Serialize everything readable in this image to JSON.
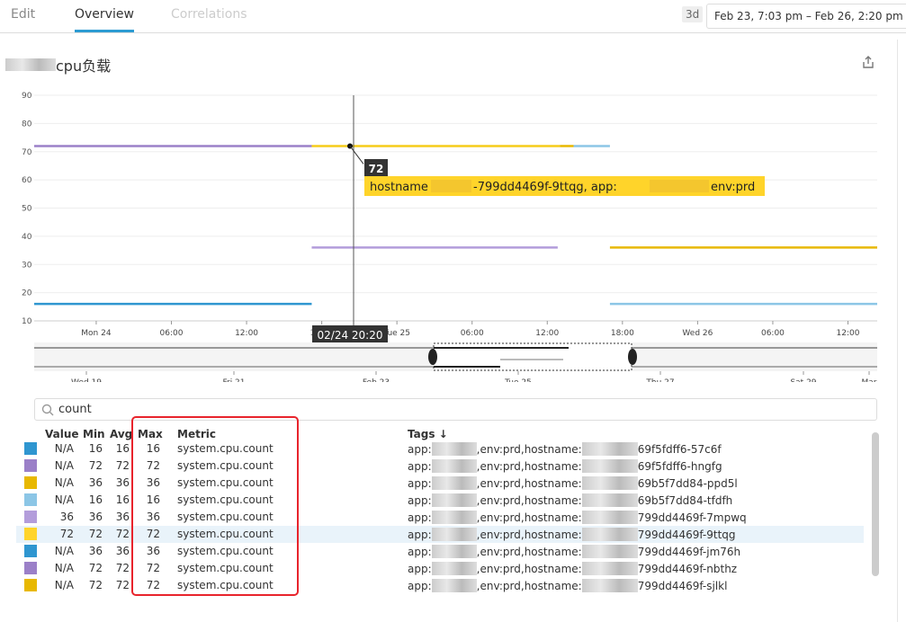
{
  "tabs": [
    {
      "label": "Edit"
    },
    {
      "label": "Overview"
    },
    {
      "label": "Correlations"
    }
  ],
  "time": {
    "preset": "3d",
    "range": "Feb 23, 7:03 pm – Feb 26, 2:20 pm"
  },
  "widget": {
    "title": "cpu负载",
    "share_icon": "share-icon"
  },
  "chart_data": {
    "type": "line",
    "ylim": [
      10,
      90
    ],
    "yticks": [
      "10",
      "20",
      "30",
      "40",
      "50",
      "60",
      "70",
      "80",
      "90"
    ],
    "xticks": [
      "Mon 24",
      "06:00",
      "12:00",
      "18:00",
      "Tue 25",
      "06:00",
      "12:00",
      "18:00",
      "Wed 26",
      "06:00",
      "12:00"
    ],
    "xrange": [
      "2020-02-23T19:03",
      "2020-02-26T14:20"
    ],
    "grid": true,
    "series": [
      {
        "color": "#9b80c8",
        "value": 72,
        "start": "2020-02-23T19:03",
        "end": "2020-02-24T17:12"
      },
      {
        "color": "#f5cc1a",
        "value": 72,
        "start": "2020-02-24T17:12",
        "end": "2020-02-25T13:00"
      },
      {
        "color": "#e8b800",
        "value": 72,
        "start": "2020-02-25T13:00",
        "end": "2020-02-25T14:06"
      },
      {
        "color": "#8cc6e6",
        "value": 72,
        "start": "2020-02-25T14:06",
        "end": "2020-02-25T17:00"
      },
      {
        "color": "#b39ddb",
        "value": 36,
        "start": "2020-02-24T17:12",
        "end": "2020-02-25T12:50"
      },
      {
        "color": "#e8b800",
        "value": 36,
        "start": "2020-02-25T17:00",
        "end": "2020-02-26T14:20"
      },
      {
        "color": "#2f96d0",
        "value": 16,
        "start": "2020-02-23T19:03",
        "end": "2020-02-24T17:12"
      },
      {
        "color": "#8cc6e6",
        "value": 16,
        "start": "2020-02-25T17:00",
        "end": "2020-02-26T14:20"
      }
    ],
    "tooltip": {
      "value": "72",
      "label_prefix": "hostname",
      "label_mid": "-799dd4469f-9ttqg, app:",
      "label_suffix": "env:prd",
      "time": "02/24 20:20"
    },
    "navigator_ticks": [
      "Wed 19",
      "Fri 21",
      "Feb 23",
      "Tue 25",
      "Thu 27",
      "Sat 29",
      "Mar"
    ]
  },
  "search": {
    "value": "count"
  },
  "legend": {
    "headers": {
      "value": "Value",
      "min": "Min",
      "avg": "Avg",
      "max": "Max",
      "metric": "Metric",
      "tags": "Tags ↓"
    },
    "rows": [
      {
        "color": "#2f96d0",
        "value": "N/A",
        "min": "16",
        "avg": "16",
        "max": "16",
        "metric": "system.cpu.count",
        "tag_a": "app:",
        "tag_b": ",env:prd,hostname:",
        "tag_c": "69f5fdff6-57c6f"
      },
      {
        "color": "#9b80c8",
        "value": "N/A",
        "min": "72",
        "avg": "72",
        "max": "72",
        "metric": "system.cpu.count",
        "tag_a": "app:",
        "tag_b": ",env:prd,hostname:",
        "tag_c": "69f5fdff6-hngfg"
      },
      {
        "color": "#e8b800",
        "value": "N/A",
        "min": "36",
        "avg": "36",
        "max": "36",
        "metric": "system.cpu.count",
        "tag_a": "app:",
        "tag_b": ",env:prd,hostname:",
        "tag_c": "69b5f7dd84-ppd5l"
      },
      {
        "color": "#8cc6e6",
        "value": "N/A",
        "min": "16",
        "avg": "16",
        "max": "16",
        "metric": "system.cpu.count",
        "tag_a": "app:",
        "tag_b": ",env:prd,hostname:",
        "tag_c": "69b5f7dd84-tfdfh"
      },
      {
        "color": "#b39ddb",
        "value": "36",
        "min": "36",
        "avg": "36",
        "max": "36",
        "metric": "system.cpu.count",
        "tag_a": "app:",
        "tag_b": ",env:prd,hostname:",
        "tag_c": "799dd4469f-7mpwq"
      },
      {
        "color": "#ffd42a",
        "value": "72",
        "min": "72",
        "avg": "72",
        "max": "72",
        "metric": "system.cpu.count",
        "tag_a": "app:",
        "tag_b": ",env:prd,hostname:",
        "tag_c": "799dd4469f-9ttqg",
        "selected": true
      },
      {
        "color": "#2f96d0",
        "value": "N/A",
        "min": "36",
        "avg": "36",
        "max": "36",
        "metric": "system.cpu.count",
        "tag_a": "app:",
        "tag_b": ",env:prd,hostname:",
        "tag_c": "799dd4469f-jm76h"
      },
      {
        "color": "#9b80c8",
        "value": "N/A",
        "min": "72",
        "avg": "72",
        "max": "72",
        "metric": "system.cpu.count",
        "tag_a": "app:",
        "tag_b": ",env:prd,hostname:",
        "tag_c": "799dd4469f-nbthz"
      },
      {
        "color": "#e8b800",
        "value": "N/A",
        "min": "72",
        "avg": "72",
        "max": "72",
        "metric": "system.cpu.count",
        "tag_a": "app:",
        "tag_b": ",env:prd,hostname:",
        "tag_c": "799dd4469f-sjlkl"
      }
    ]
  }
}
